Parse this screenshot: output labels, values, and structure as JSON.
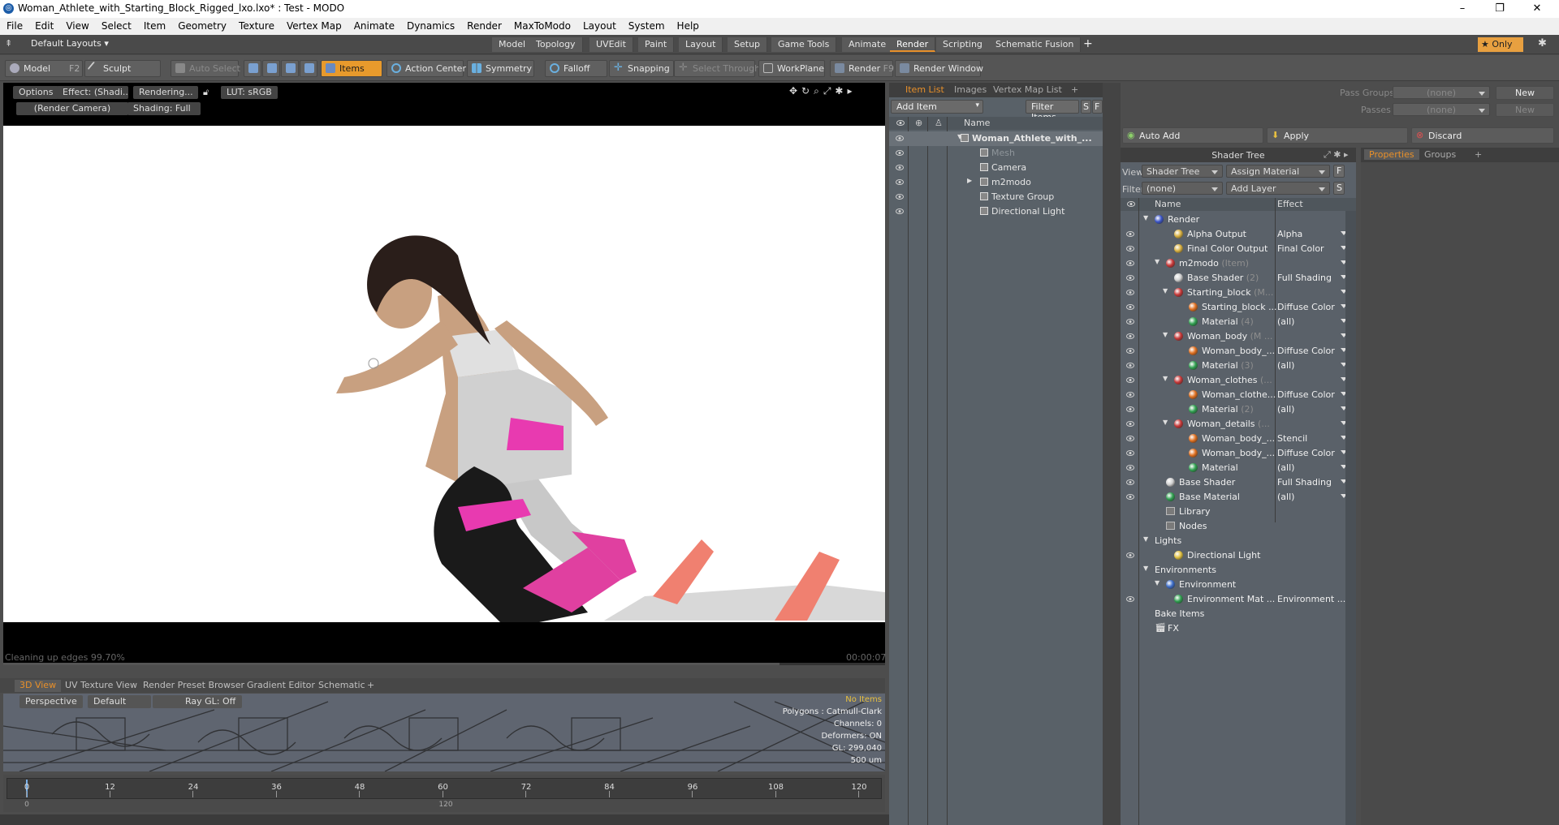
{
  "window": {
    "title": "Woman_Athlete_with_Starting_Block_Rigged_lxo.lxo* : Test - MODO",
    "app_icon": "modo-logo-icon",
    "controls": [
      "–",
      "❐",
      "✕"
    ]
  },
  "menu": [
    "File",
    "Edit",
    "View",
    "Select",
    "Item",
    "Geometry",
    "Texture",
    "Vertex Map",
    "Animate",
    "Dynamics",
    "Render",
    "MaxToModo",
    "Layout",
    "System",
    "Help"
  ],
  "layouts": {
    "selector": "Default Layouts",
    "tabs": [
      "Model",
      "Topology",
      "UVEdit",
      "Paint",
      "Layout",
      "Setup",
      "Game Tools",
      "Animate",
      "Render",
      "Scripting",
      "Schematic Fusion"
    ],
    "active_tab": "Render",
    "add": "+",
    "only_label": "Only"
  },
  "toolbar": {
    "model": "Model",
    "model_key": "F2",
    "sculpt": "Sculpt",
    "auto_select": "Auto Select",
    "items": "Items",
    "action_center": "Action Center",
    "symmetry": "Symmetry",
    "falloff": "Falloff",
    "snapping": "Snapping",
    "select_through": "Select Through",
    "workplane": "WorkPlane",
    "render": "Render",
    "render_key": "F9",
    "render_window": "Render Window"
  },
  "viewport": {
    "options": "Options",
    "effect": "Effect: (Shadi...",
    "rendering": "Rendering...",
    "lut": "LUT: sRGB",
    "camera": "(Render Camera)",
    "shading": "Shading: Full",
    "status_left": "Cleaning up edges 99.70%",
    "status_right": "00:00:07"
  },
  "bottom_tabs": [
    "3D View",
    "UV Texture View",
    "Render Preset Browser",
    "Gradient Editor",
    "Schematic",
    "+"
  ],
  "bottom_active": "3D View",
  "view3d": {
    "perspective": "Perspective",
    "default": "Default",
    "raygl": "Ray GL: Off",
    "info": [
      "No Items",
      "Polygons : Catmull-Clark",
      "Channels: 0",
      "Deformers: ON",
      "GL: 299,040",
      "500 um"
    ]
  },
  "timeline": {
    "ticks": [
      "0",
      "12",
      "24",
      "36",
      "48",
      "60",
      "72",
      "84",
      "96",
      "108",
      "120"
    ],
    "sub_ticks": [
      "0",
      "120"
    ]
  },
  "item_list": {
    "tabs": [
      "Item List",
      "Images",
      "Vertex Map List",
      "+"
    ],
    "active_tab": "Item List",
    "add_item": "Add Item",
    "filter_items": "Filter Items",
    "s_btn": "S",
    "f_btn": "F",
    "col_name": "Name",
    "rows": [
      {
        "name": "Woman_Athlete_with_...",
        "bold": true,
        "level": 0,
        "eye": true
      },
      {
        "name": "Mesh",
        "dim": true,
        "level": 1,
        "eye": true
      },
      {
        "name": "Camera",
        "level": 1,
        "eye": true
      },
      {
        "name": "m2modo",
        "level": 1,
        "eye": true
      },
      {
        "name": "Texture Group",
        "level": 1,
        "eye": true
      },
      {
        "name": "Directional Light",
        "level": 1,
        "eye": true
      }
    ]
  },
  "pass": {
    "pass_groups_label": "Pass Groups",
    "pass_groups_value": "(none)",
    "passes_label": "Passes",
    "passes_value": "(none)",
    "new": "New",
    "new2": "New"
  },
  "actions": {
    "auto_add": "Auto Add",
    "apply": "Apply",
    "discard": "Discard"
  },
  "shader_tree": {
    "title": "Shader Tree",
    "view_label": "View",
    "view_value": "Shader Tree",
    "assign_material": "Assign Material",
    "f_btn": "F",
    "filter_label": "Filter",
    "filter_value": "(none)",
    "add_layer": "Add Layer",
    "s_btn": "S",
    "col_name": "Name",
    "col_effect": "Effect",
    "rows": [
      {
        "name": "Render",
        "suffix": "",
        "effect": "",
        "indent": 0,
        "eye": false,
        "ball": "#3c56c8"
      },
      {
        "name": "Alpha Output",
        "suffix": "",
        "effect": "Alpha",
        "indent": 2,
        "eye": true,
        "ball": "#d8b040"
      },
      {
        "name": "Final Color Output",
        "suffix": "",
        "effect": "Final Color",
        "indent": 2,
        "eye": true,
        "ball": "#d8b040"
      },
      {
        "name": "m2modo",
        "suffix": "(Item)",
        "effect": "",
        "indent": 1,
        "eye": true,
        "ball": "#c83838"
      },
      {
        "name": "Base Shader",
        "suffix": "(2)",
        "effect": "Full Shading",
        "indent": 2,
        "eye": true,
        "ball": "#d0d0d0"
      },
      {
        "name": "Starting_block",
        "suffix": "(M...",
        "effect": "",
        "indent": 2,
        "eye": true,
        "ball": "#c83838"
      },
      {
        "name": "Starting_block ...",
        "suffix": "",
        "effect": "Diffuse Color",
        "indent": 3,
        "eye": true,
        "ball": "#e07020"
      },
      {
        "name": "Material",
        "suffix": "(4)",
        "effect": "(all)",
        "indent": 3,
        "eye": true,
        "ball": "#30a050"
      },
      {
        "name": "Woman_body",
        "suffix": "(M ...",
        "effect": "",
        "indent": 2,
        "eye": true,
        "ball": "#c83838"
      },
      {
        "name": "Woman_body_...",
        "suffix": "",
        "effect": "Diffuse Color",
        "indent": 3,
        "eye": true,
        "ball": "#e07020"
      },
      {
        "name": "Material",
        "suffix": "(3)",
        "effect": "(all)",
        "indent": 3,
        "eye": true,
        "ball": "#30a050"
      },
      {
        "name": "Woman_clothes",
        "suffix": "(...",
        "effect": "",
        "indent": 2,
        "eye": true,
        "ball": "#c83838"
      },
      {
        "name": "Woman_clothe...",
        "suffix": "",
        "effect": "Diffuse Color",
        "indent": 3,
        "eye": true,
        "ball": "#e07020"
      },
      {
        "name": "Material",
        "suffix": "(2)",
        "effect": "(all)",
        "indent": 3,
        "eye": true,
        "ball": "#30a050"
      },
      {
        "name": "Woman_details",
        "suffix": "(...",
        "effect": "",
        "indent": 2,
        "eye": true,
        "ball": "#c83838"
      },
      {
        "name": "Woman_body_...",
        "suffix": "",
        "effect": "Stencil",
        "indent": 3,
        "eye": true,
        "ball": "#e07020"
      },
      {
        "name": "Woman_body_...",
        "suffix": "",
        "effect": "Diffuse Color",
        "indent": 3,
        "eye": true,
        "ball": "#e07020"
      },
      {
        "name": "Material",
        "suffix": "",
        "effect": "(all)",
        "indent": 3,
        "eye": true,
        "ball": "#30a050"
      },
      {
        "name": "Base Shader",
        "suffix": "",
        "effect": "Full Shading",
        "indent": 1,
        "eye": true,
        "ball": "#d0d0d0"
      },
      {
        "name": "Base Material",
        "suffix": "",
        "effect": "(all)",
        "indent": 1,
        "eye": true,
        "ball": "#30a050"
      },
      {
        "name": "Library",
        "suffix": "",
        "effect": "",
        "indent": 1,
        "eye": false,
        "ball": ""
      },
      {
        "name": "Nodes",
        "suffix": "",
        "effect": "",
        "indent": 1,
        "eye": false,
        "ball": ""
      },
      {
        "name": "Lights",
        "suffix": "",
        "effect": "",
        "indent": 0,
        "eye": false,
        "ball": ""
      },
      {
        "name": "Directional Light",
        "suffix": "",
        "effect": "",
        "indent": 2,
        "eye": true,
        "ball": "#e0c040"
      },
      {
        "name": "Environments",
        "suffix": "",
        "effect": "",
        "indent": 0,
        "eye": false,
        "ball": ""
      },
      {
        "name": "Environment",
        "suffix": "",
        "effect": "",
        "indent": 1,
        "eye": false,
        "ball": "#3c6cc8"
      },
      {
        "name": "Environment Mat ...",
        "suffix": "",
        "effect": "Environment ...",
        "indent": 2,
        "eye": true,
        "ball": "#30a050"
      },
      {
        "name": "Bake Items",
        "suffix": "",
        "effect": "",
        "indent": 0,
        "eye": false,
        "ball": ""
      },
      {
        "name": "FX",
        "suffix": "",
        "effect": "",
        "indent": 0,
        "eye": false,
        "ball": ""
      }
    ]
  },
  "properties": {
    "tabs": [
      "Properties",
      "Groups",
      "+"
    ],
    "active_tab": "Properties"
  }
}
